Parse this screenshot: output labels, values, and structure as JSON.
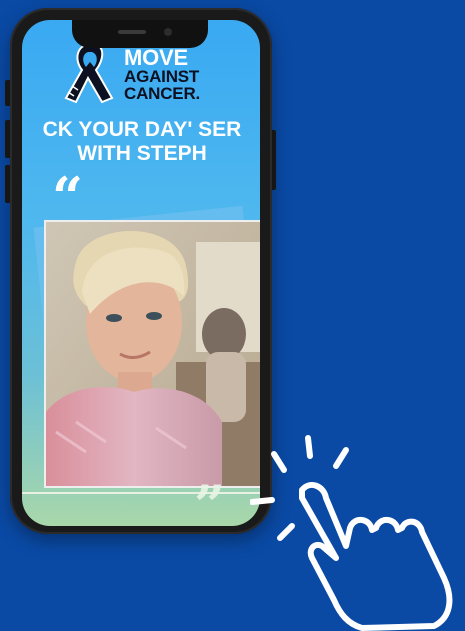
{
  "logo": {
    "lines": [
      "MOVE",
      "AGAINST",
      "CANCER."
    ]
  },
  "headline": {
    "line1": "CK YOUR DAY' SER",
    "line2": "WITH STEPH"
  },
  "quotes": {
    "open": "“",
    "close": "”"
  },
  "colors": {
    "background": "#0a4aa5",
    "screen_top": "#39a9f2",
    "screen_bottom": "#a9d7a9",
    "text": "#ffffff",
    "logo_dark": "#0c1020"
  },
  "icons": {
    "ribbon": "awareness-ribbon-icon",
    "pointer": "hand-pointer-icon"
  }
}
